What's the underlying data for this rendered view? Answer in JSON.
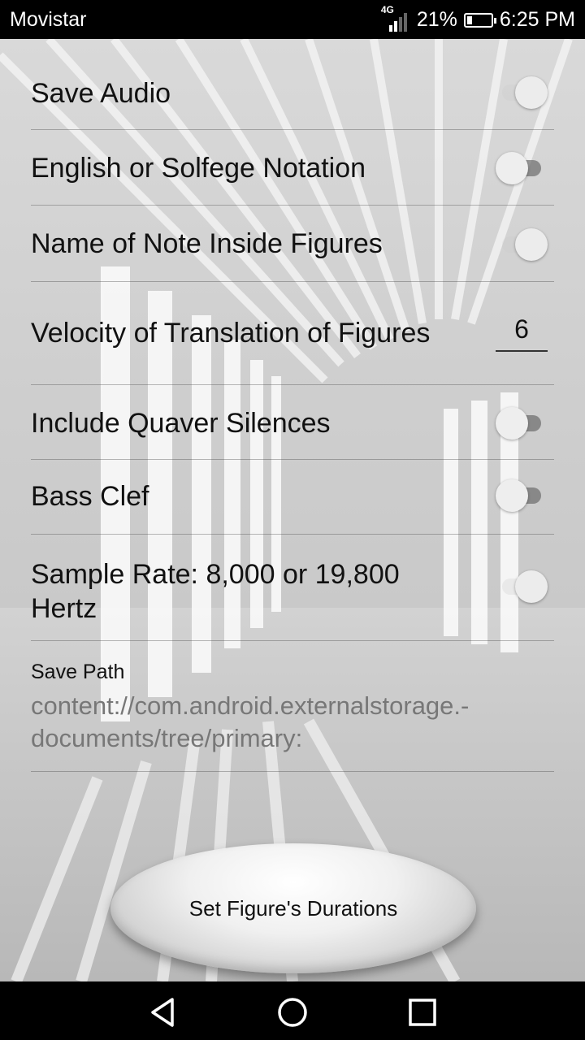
{
  "status_bar": {
    "carrier": "Movistar",
    "network": "4G",
    "battery_percent": "21%",
    "battery_level": 0.21,
    "time": "6:25 PM"
  },
  "settings": {
    "save_audio": {
      "label": "Save Audio",
      "enabled": true
    },
    "notation": {
      "label": "English or Solfege Notation",
      "enabled": false
    },
    "note_name_inside": {
      "label": "Name of Note Inside Figures",
      "enabled": true
    },
    "velocity": {
      "label": "Velocity of Translation of Figures",
      "value": "6"
    },
    "quaver_silences": {
      "label": "Include Quaver Silences",
      "enabled": false
    },
    "bass_clef": {
      "label": "Bass Clef",
      "enabled": false
    },
    "sample_rate": {
      "label_line1": "Sample Rate: 8,000 or 19,800",
      "label_line2": "Hertz",
      "enabled": true
    },
    "save_path": {
      "title": "Save Path",
      "value_line1": "content://com.android.externalstorage.-",
      "value_line2": "documents/tree/primary:"
    }
  },
  "action_button": {
    "label": "Set Figure's Durations"
  },
  "nav": {
    "back_icon": "back-triangle",
    "home_icon": "home-circle",
    "recents_icon": "recents-square"
  }
}
